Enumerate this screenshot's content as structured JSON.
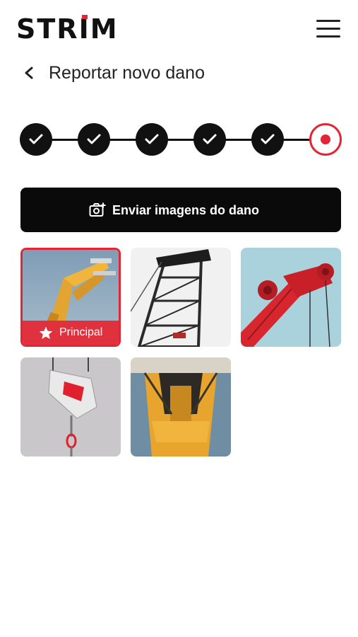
{
  "header": {
    "logo": "STRIM",
    "menu_icon": "hamburger-icon"
  },
  "page": {
    "title": "Reportar novo dano",
    "back_icon": "chevron-left-icon"
  },
  "stepper": {
    "total_steps": 6,
    "completed_steps": 5,
    "current_step": 6,
    "accent_color": "#e32636"
  },
  "upload": {
    "label": "Enviar imagens do dano",
    "icon": "camera-add-icon"
  },
  "gallery": {
    "badge_label": "Principal",
    "badge_icon": "star-icon",
    "images": [
      {
        "subject": "yellow-crane-arm",
        "principal": true
      },
      {
        "subject": "black-lattice-crane",
        "principal": false
      },
      {
        "subject": "red-crane-pulley",
        "principal": false
      },
      {
        "subject": "red-crane-hook",
        "principal": false
      },
      {
        "subject": "yellow-tower-crane",
        "principal": false
      }
    ]
  }
}
